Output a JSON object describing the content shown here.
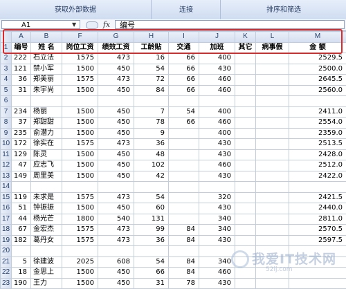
{
  "ribbon": {
    "groups": [
      "获取外部数据",
      "连接",
      "排序和筛选"
    ]
  },
  "namebar": {
    "name_box": "A1",
    "fx_label": "fx",
    "formula": "编号"
  },
  "sheet": {
    "columns": [
      "A",
      "B",
      "F",
      "G",
      "H",
      "I",
      "J",
      "K",
      "L",
      "M"
    ],
    "rows": [
      {
        "num": "1",
        "cells": [
          "编号",
          "姓 名",
          "岗位工资",
          "绩效工资",
          "工龄贴",
          "交通",
          "加班",
          "其它",
          "病事假",
          "金  额"
        ]
      },
      {
        "num": "2",
        "cells": [
          "222",
          "石立法",
          "1575",
          "473",
          "16",
          "66",
          "400",
          "",
          "",
          "2529.5"
        ]
      },
      {
        "num": "3",
        "cells": [
          "121",
          "禁小军",
          "1500",
          "450",
          "54",
          "66",
          "430",
          "",
          "",
          "2500.0"
        ]
      },
      {
        "num": "4",
        "cells": [
          "36",
          "郑美丽",
          "1575",
          "473",
          "72",
          "66",
          "460",
          "",
          "",
          "2645.5"
        ]
      },
      {
        "num": "5",
        "cells": [
          "31",
          "朱宇尚",
          "1500",
          "450",
          "84",
          "66",
          "460",
          "",
          "",
          "2560.0"
        ]
      },
      {
        "num": "6",
        "cells": [
          "",
          "",
          "",
          "",
          "",
          "",
          "",
          "",
          "",
          ""
        ]
      },
      {
        "num": "7",
        "cells": [
          "234",
          "杨丽",
          "1500",
          "450",
          "7",
          "54",
          "400",
          "",
          "",
          "2411.0"
        ]
      },
      {
        "num": "8",
        "cells": [
          "37",
          "郑甜甜",
          "1500",
          "450",
          "78",
          "66",
          "460",
          "",
          "",
          "2554.0"
        ]
      },
      {
        "num": "9",
        "cells": [
          "235",
          "俞潜力",
          "1500",
          "450",
          "9",
          "",
          "400",
          "",
          "",
          "2359.0"
        ]
      },
      {
        "num": "10",
        "cells": [
          "172",
          "徐实在",
          "1575",
          "473",
          "36",
          "",
          "430",
          "",
          "",
          "2513.5"
        ]
      },
      {
        "num": "11",
        "cells": [
          "129",
          "陈灵",
          "1500",
          "450",
          "48",
          "",
          "430",
          "",
          "",
          "2428.0"
        ]
      },
      {
        "num": "12",
        "cells": [
          "47",
          "应志飞",
          "1500",
          "450",
          "102",
          "",
          "460",
          "",
          "",
          "2512.0"
        ]
      },
      {
        "num": "13",
        "cells": [
          "149",
          "周里美",
          "1500",
          "450",
          "42",
          "",
          "430",
          "",
          "",
          "2422.0"
        ]
      },
      {
        "num": "14",
        "cells": [
          "",
          "",
          "",
          "",
          "",
          "",
          "",
          "",
          "",
          ""
        ]
      },
      {
        "num": "15",
        "cells": [
          "119",
          "未求是",
          "1575",
          "473",
          "54",
          "",
          "320",
          "",
          "",
          "2421.5"
        ]
      },
      {
        "num": "16",
        "cells": [
          "51",
          "钟振振",
          "1500",
          "450",
          "60",
          "",
          "430",
          "",
          "",
          "2440.0"
        ]
      },
      {
        "num": "17",
        "cells": [
          "44",
          "杨光芒",
          "1800",
          "540",
          "131",
          "",
          "340",
          "",
          "",
          "2811.0"
        ]
      },
      {
        "num": "18",
        "cells": [
          "67",
          "金宏杰",
          "1575",
          "473",
          "99",
          "84",
          "340",
          "",
          "",
          "2570.5"
        ]
      },
      {
        "num": "19",
        "cells": [
          "182",
          "葛丹女",
          "1575",
          "473",
          "36",
          "84",
          "430",
          "",
          "",
          "2597.5"
        ]
      },
      {
        "num": "20",
        "cells": [
          "",
          "",
          "",
          "",
          "",
          "",
          "",
          "",
          "",
          ""
        ]
      },
      {
        "num": "21",
        "cells": [
          "5",
          "徐建波",
          "2025",
          "608",
          "54",
          "84",
          "340",
          "",
          "",
          ""
        ]
      },
      {
        "num": "22",
        "cells": [
          "18",
          "金思上",
          "1500",
          "450",
          "66",
          "84",
          "460",
          "",
          "",
          ""
        ]
      },
      {
        "num": "23",
        "cells": [
          "190",
          "王力",
          "1500",
          "450",
          "31",
          "78",
          "430",
          "",
          "",
          ""
        ]
      }
    ]
  },
  "watermark": {
    "text": "我爱IT技术网",
    "sub": "52ij.com"
  },
  "colors": {
    "highlight": "#d92b2b",
    "header_bg": "#d4def0",
    "grid": "#c3ccda"
  }
}
